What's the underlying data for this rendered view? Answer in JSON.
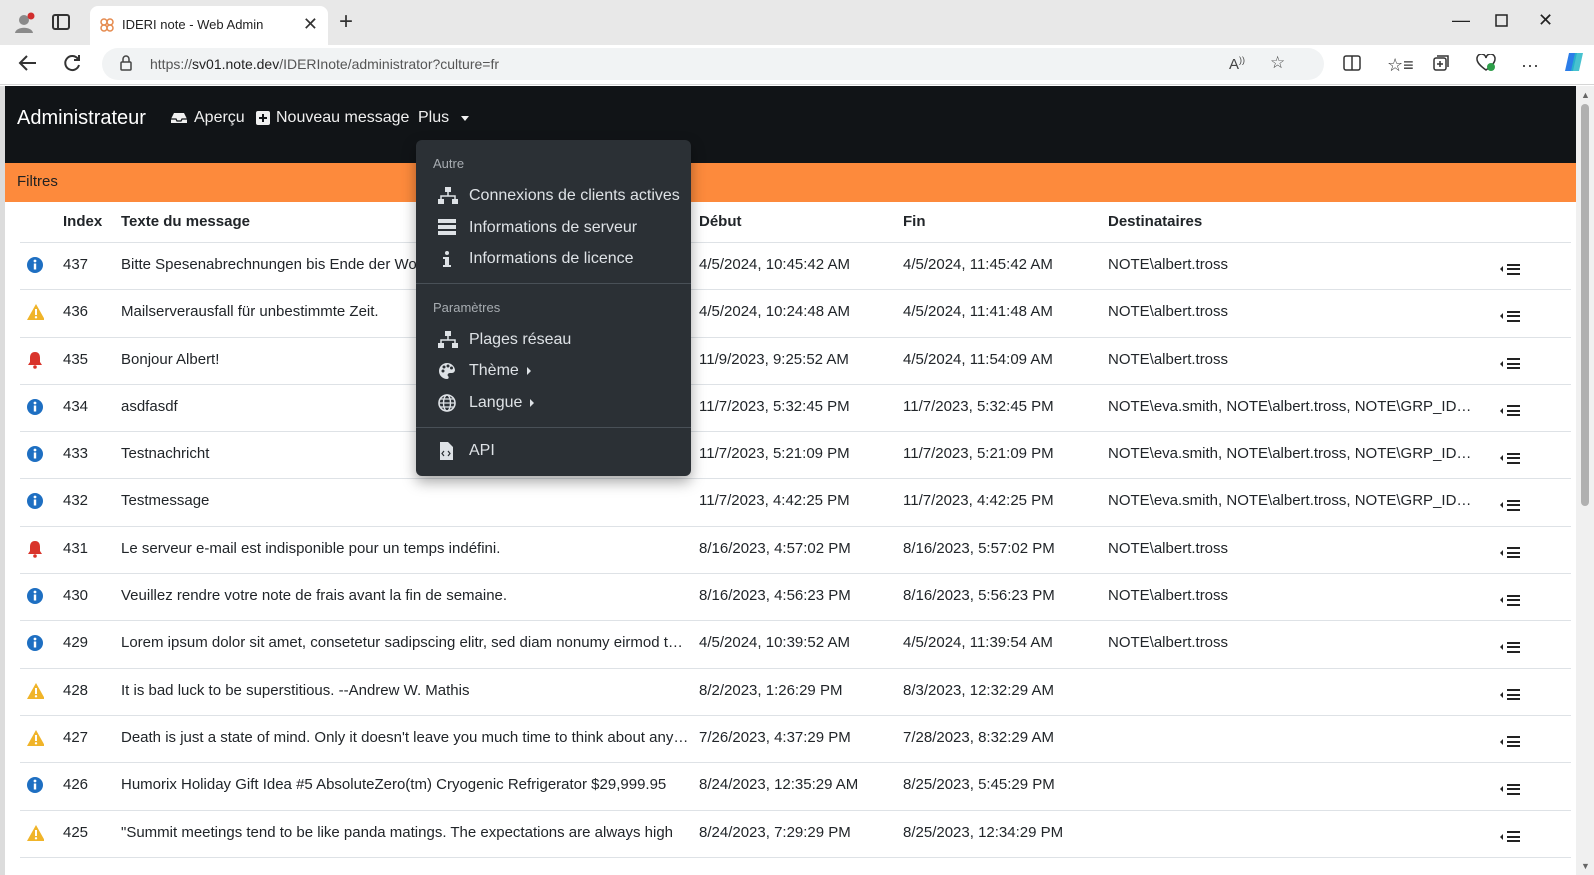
{
  "browser": {
    "tab_title": "IDERI note - Web Admin",
    "url_prefix": "https://",
    "url_host": "sv01.note.dev",
    "url_path": "/IDERInote/administrator?culture=fr"
  },
  "app": {
    "brand": "Administrateur",
    "nav": {
      "preview_label": "Aperçu",
      "new_message_label": "Nouveau message",
      "more_label": "Plus"
    },
    "filters_label": "Filtres"
  },
  "dropdown": {
    "section_other": "Autre",
    "active_clients": "Connexions de clients actives",
    "server_info": "Informations de serveur",
    "license_info": "Informations de licence",
    "section_settings": "Paramètres",
    "network_ranges": "Plages réseau",
    "theme": "Thème",
    "language": "Langue",
    "api": "API"
  },
  "table": {
    "headers": {
      "index": "Index",
      "text": "Texte du message",
      "start": "Début",
      "end": "Fin",
      "recipients": "Destinataires"
    },
    "rows": [
      {
        "type": "info",
        "index": "437",
        "text": "Bitte Spesenabrechnungen bis Ende der Woche einreichen.",
        "start": "4/5/2024, 10:45:42 AM",
        "end": "4/5/2024, 11:45:42 AM",
        "recipients": "NOTE\\albert.tross"
      },
      {
        "type": "warning",
        "index": "436",
        "text": "Mailserverausfall für unbestimmte Zeit.",
        "start": "4/5/2024, 10:24:48 AM",
        "end": "4/5/2024, 11:41:48 AM",
        "recipients": "NOTE\\albert.tross"
      },
      {
        "type": "alarm",
        "index": "435",
        "text": "Bonjour Albert!",
        "start": "11/9/2023, 9:25:52 AM",
        "end": "4/5/2024, 11:54:09 AM",
        "recipients": "NOTE\\albert.tross"
      },
      {
        "type": "info",
        "index": "434",
        "text": "asdfasdf",
        "start": "11/7/2023, 5:32:45 PM",
        "end": "11/7/2023, 5:32:45 PM",
        "recipients": "NOTE\\eva.smith, NOTE\\albert.tross, NOTE\\GRP_IDERI"
      },
      {
        "type": "info",
        "index": "433",
        "text": "Testnachricht",
        "start": "11/7/2023, 5:21:09 PM",
        "end": "11/7/2023, 5:21:09 PM",
        "recipients": "NOTE\\eva.smith, NOTE\\albert.tross, NOTE\\GRP_IDERI"
      },
      {
        "type": "info",
        "index": "432",
        "text": "Testmessage",
        "start": "11/7/2023, 4:42:25 PM",
        "end": "11/7/2023, 4:42:25 PM",
        "recipients": "NOTE\\eva.smith, NOTE\\albert.tross, NOTE\\GRP_IDERI"
      },
      {
        "type": "alarm",
        "index": "431",
        "text": "Le serveur e-mail est indisponible pour un temps indéfini.",
        "start": "8/16/2023, 4:57:02 PM",
        "end": "8/16/2023, 5:57:02 PM",
        "recipients": "NOTE\\albert.tross"
      },
      {
        "type": "info",
        "index": "430",
        "text": "Veuillez rendre votre note de frais avant la fin de semaine.",
        "start": "8/16/2023, 4:56:23 PM",
        "end": "8/16/2023, 5:56:23 PM",
        "recipients": "NOTE\\albert.tross"
      },
      {
        "type": "info",
        "index": "429",
        "text": "Lorem ipsum dolor sit amet, consetetur sadipscing elitr, sed diam nonumy eirmod tempor",
        "start": "4/5/2024, 10:39:52 AM",
        "end": "4/5/2024, 11:39:54 AM",
        "recipients": "NOTE\\albert.tross"
      },
      {
        "type": "warning",
        "index": "428",
        "text": "It is bad luck to be superstitious. --Andrew W. Mathis",
        "start": "8/2/2023, 1:26:29 PM",
        "end": "8/3/2023, 12:32:29 AM",
        "recipients": ""
      },
      {
        "type": "warning",
        "index": "427",
        "text": "Death is just a state of mind. Only it doesn't leave you much time to think about anything",
        "start": "7/26/2023, 4:37:29 PM",
        "end": "7/28/2023, 8:32:29 AM",
        "recipients": ""
      },
      {
        "type": "info",
        "index": "426",
        "text": "Humorix Holiday Gift Idea #5 AbsoluteZero(tm) Cryogenic Refrigerator $29,999.95",
        "start": "8/24/2023, 12:35:29 AM",
        "end": "8/25/2023, 5:45:29 PM",
        "recipients": ""
      },
      {
        "type": "warning",
        "index": "425",
        "text": "\"Summit meetings tend to be like panda matings. The expectations are always high",
        "start": "8/24/2023, 7:29:29 PM",
        "end": "8/25/2023, 12:34:29 PM",
        "recipients": ""
      }
    ]
  },
  "colors": {
    "navbar": "#111417",
    "filters": "#fd8a3c",
    "info": "#1e6fc2",
    "warning": "#f0b429",
    "alarm": "#d9342b",
    "dropdown": "#2b3035"
  }
}
